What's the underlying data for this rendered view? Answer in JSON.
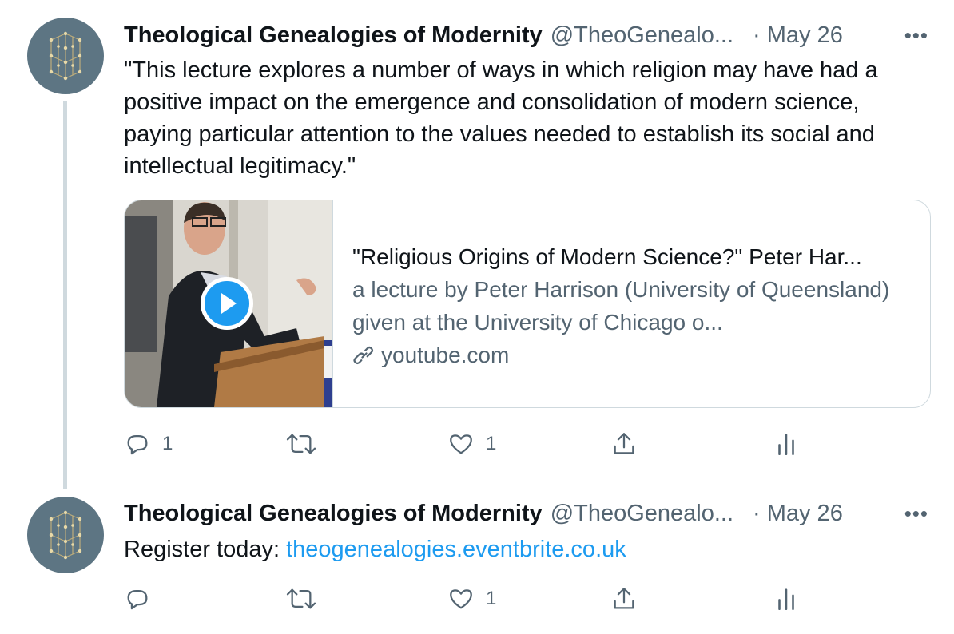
{
  "tweets": [
    {
      "author_name": "Theological Genealogies of Modernity",
      "author_handle": "@TheoGenealo...",
      "separator": "·",
      "date": "May 26",
      "more": "•••",
      "text": "\"This lecture explores a number of ways in which religion may have had a positive impact on the emergence and consolidation of modern science, paying particular attention to the values needed to establish its social and intellectual legitimacy.\"",
      "card": {
        "title": "\"Religious Origins of Modern Science?\" Peter Har...",
        "description": "a lecture by Peter Harrison (University of Queensland) given at the University of Chicago o...",
        "domain": "youtube.com"
      },
      "actions": {
        "reply_count": "1",
        "retweet_count": "",
        "like_count": "1"
      }
    },
    {
      "author_name": "Theological Genealogies of Modernity",
      "author_handle": "@TheoGenealo...",
      "separator": "·",
      "date": "May 26",
      "more": "•••",
      "text_prefix": "Register today: ",
      "link": "theogenealogies.eventbrite.co.uk",
      "actions": {
        "reply_count": "",
        "retweet_count": "",
        "like_count": "1"
      }
    }
  ],
  "colors": {
    "link": "#1d9bf0",
    "secondary": "#536471",
    "avatar": "#5d7583"
  },
  "icons": [
    "reply-icon",
    "retweet-icon",
    "like-icon",
    "share-icon",
    "analytics-icon",
    "play-icon",
    "link-icon",
    "more-icon"
  ]
}
